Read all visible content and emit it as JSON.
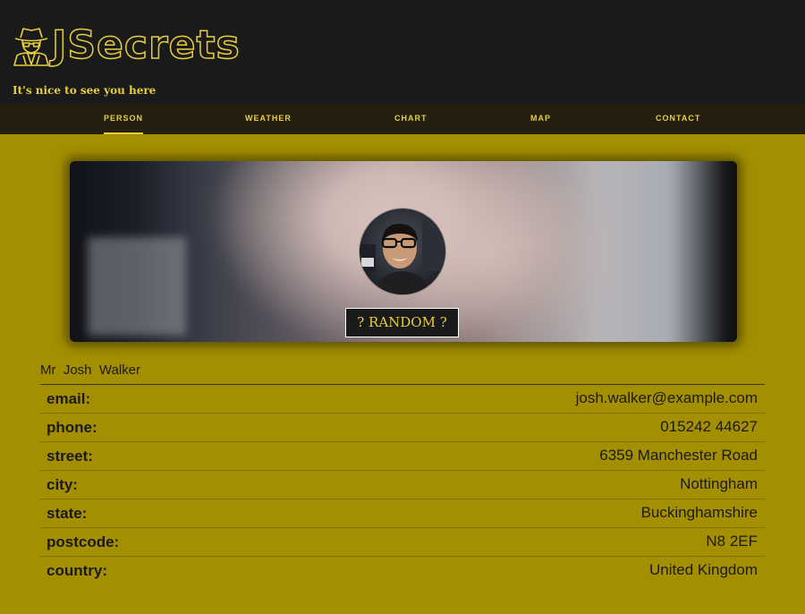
{
  "app": {
    "title": "JSecrets",
    "tagline": "It's nice to see you here",
    "logo_icon": "spy-icon",
    "accent_color": "#e6cf3c",
    "header_bg": "#1a1a1a",
    "page_bg": "#a48f00"
  },
  "nav": {
    "items": [
      {
        "label": "PERSON",
        "active": true
      },
      {
        "label": "WEATHER",
        "active": false
      },
      {
        "label": "CHART",
        "active": false
      },
      {
        "label": "MAP",
        "active": false
      },
      {
        "label": "CONTACT",
        "active": false
      }
    ]
  },
  "profile": {
    "random_button": "? RANDOM ?",
    "title": "Mr",
    "first_name": "Josh",
    "last_name": "Walker",
    "fields": [
      {
        "key": "email:",
        "value": "josh.walker@example.com"
      },
      {
        "key": "phone:",
        "value": "015242 44627"
      },
      {
        "key": "street:",
        "value": "6359 Manchester Road"
      },
      {
        "key": "city:",
        "value": "Nottingham"
      },
      {
        "key": "state:",
        "value": "Buckinghamshire"
      },
      {
        "key": "postcode:",
        "value": "N8 2EF"
      },
      {
        "key": "country:",
        "value": "United Kingdom"
      }
    ]
  }
}
